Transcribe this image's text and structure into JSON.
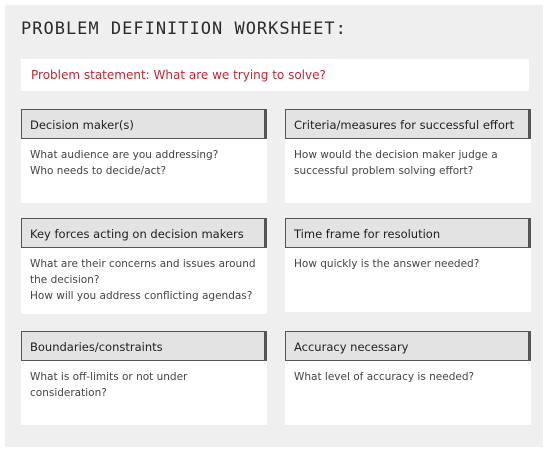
{
  "title": "PROBLEM DEFINITION WORKSHEET:",
  "problem_statement": "Problem statement: What are we trying to solve?",
  "cards": [
    {
      "heading": "Decision maker(s)",
      "lines": [
        "What audience are you addressing?",
        "Who needs to decide/act?"
      ]
    },
    {
      "heading": "Criteria/measures for successful effort",
      "lines": [
        "How would the decision maker judge a",
        "successful problem solving effort?"
      ]
    },
    {
      "heading": "Key forces acting on decision makers",
      "lines": [
        "What are their concerns and issues around",
        "the decision?",
        "How will you address conflicting agendas?"
      ]
    },
    {
      "heading": "Time frame for resolution",
      "lines": [
        "How quickly is the answer needed?"
      ]
    },
    {
      "heading": "Boundaries/constraints",
      "lines": [
        "What is off-limits or not under",
        "consideration?"
      ]
    },
    {
      "heading": "Accuracy necessary",
      "lines": [
        "What level of accuracy is needed?"
      ]
    }
  ]
}
